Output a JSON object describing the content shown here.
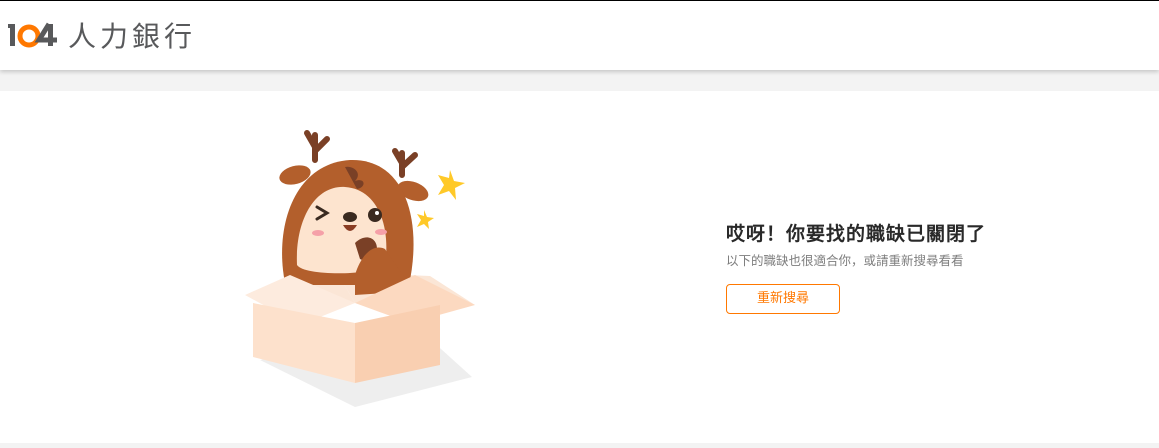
{
  "header": {
    "logo_digits": "104",
    "logo_text": "人力銀行"
  },
  "message": {
    "title": "哎呀！你要找的職缺已關閉了",
    "subtitle": "以下的職缺也很適合你，或請重新搜尋看看",
    "button_label": "重新搜尋"
  },
  "colors": {
    "accent": "#ff7800",
    "logo_gray": "#58595b",
    "band": "#f3f3f3"
  },
  "icons": [
    "deer-in-box-illustration",
    "sparkle-icon"
  ]
}
